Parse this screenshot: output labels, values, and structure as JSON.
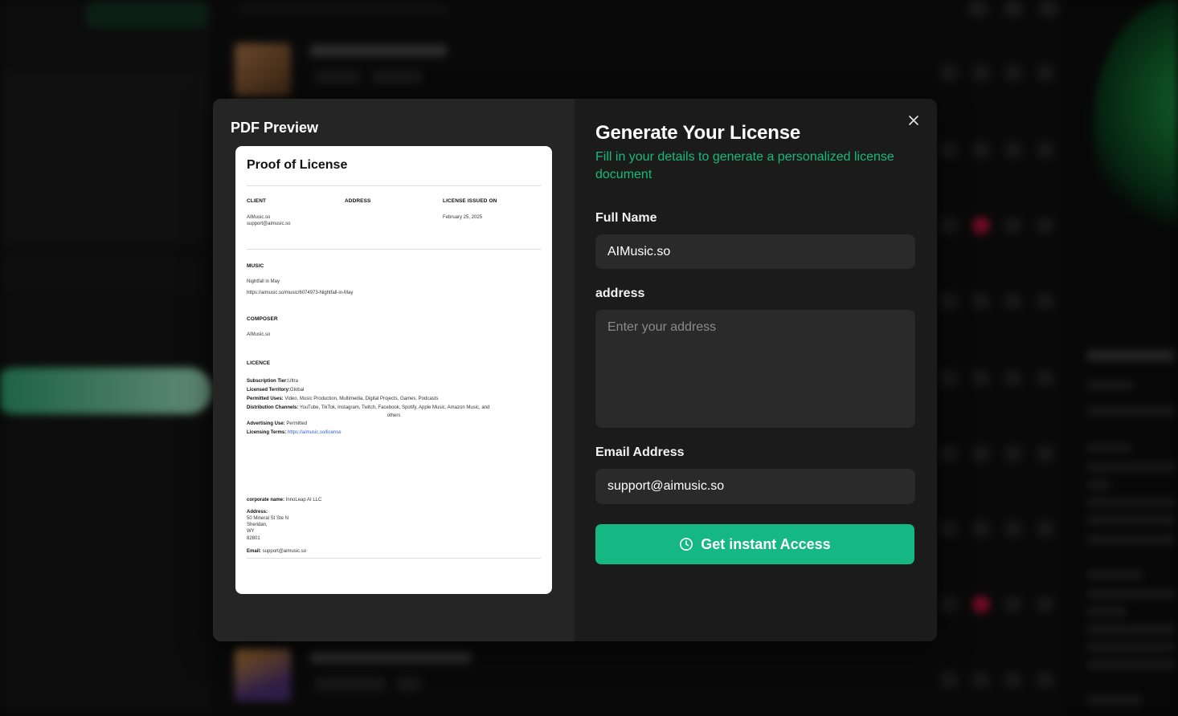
{
  "preview": {
    "title": "PDF Preview",
    "document": {
      "title": "Proof of License",
      "client_label": "CLIENT",
      "client_name": "AIMusic.so",
      "client_email": "support@aimusic.so",
      "address_label": "ADDRESS",
      "issued_label": "LICENSE ISSUED ON",
      "issued_date": "February 25, 2025",
      "music_label": "MUSIC",
      "music_title": "Nightfall in May",
      "music_url": "https://aimusic.so/music/6074973-Nightfall-in-May",
      "composer_label": "COMPOSER",
      "composer_name": "AIMusic.so",
      "licence_label": "LICENCE",
      "subscription_tier_label": "Subscription Tier:",
      "subscription_tier": "Ultra",
      "territory_label": "Licensed Territory:",
      "territory": "Global",
      "permitted_uses_label": "Permitted Uses:",
      "permitted_uses": "Video, Music Production, Multimedia, Digital Projects, Games, Podcasts",
      "channels_label": "Distribution Channels:",
      "channels": "YouTube, TikTok, Instagram, Twitch, Facebook, Spotify, Apple Music, Amazon Music, and",
      "channels_cont": "others",
      "advertising_label": "Advertising Use:",
      "advertising": "Permitted",
      "terms_label": "Licensing Terms:",
      "terms_url": "https://aimusic.so/license",
      "corporate_label": "corporate name:",
      "corporate_name": "InnoLeap AI LLC",
      "corp_address_label": "Address:",
      "corp_address_line1": "50 Mineral St Ste N",
      "corp_address_line2": "Sheridan,",
      "corp_address_line3": "WY",
      "corp_address_line4": "82801",
      "corp_email_label": "Email:",
      "corp_email": "support@aimusic.so"
    }
  },
  "form": {
    "title": "Generate Your License",
    "subtitle": "Fill in your details to generate a personalized license document",
    "full_name_label": "Full Name",
    "full_name_value": "AIMusic.so",
    "address_label": "address",
    "address_placeholder": "Enter your address",
    "email_label": "Email Address",
    "email_value": "support@aimusic.so",
    "submit_label": "Get instant Access"
  },
  "colors": {
    "accent": "#15b883",
    "subtitle": "#18b97e",
    "modal_left": "#252525",
    "modal_right": "#1b1b1b"
  }
}
